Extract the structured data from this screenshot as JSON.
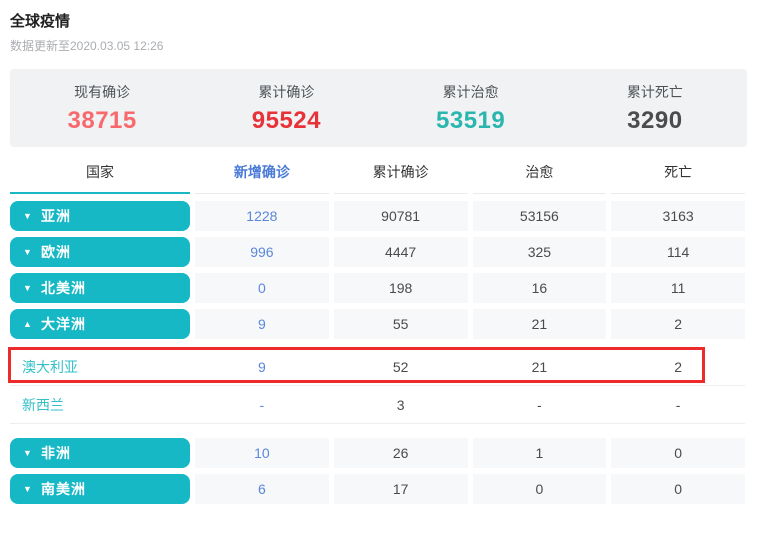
{
  "page": {
    "title": "全球疫情",
    "updated": "数据更新至2020.03.05 12:26"
  },
  "stats": [
    {
      "label": "现有确诊",
      "value": "38715",
      "color": "#f8696e"
    },
    {
      "label": "累计确诊",
      "value": "95524",
      "color": "#e73238"
    },
    {
      "label": "累计治愈",
      "value": "53519",
      "color": "#2ab6ae"
    },
    {
      "label": "累计死亡",
      "value": "3290",
      "color": "#4c4c4c"
    }
  ],
  "table": {
    "columns": [
      "国家",
      "新增确诊",
      "累计确诊",
      "治愈",
      "死亡"
    ],
    "rows": [
      {
        "type": "continent",
        "name": "亚洲",
        "arrow": "▼",
        "expanded": false,
        "new": "1228",
        "total": "90781",
        "cured": "53156",
        "dead": "3163"
      },
      {
        "type": "continent",
        "name": "欧洲",
        "arrow": "▼",
        "expanded": false,
        "new": "996",
        "total": "4447",
        "cured": "325",
        "dead": "114"
      },
      {
        "type": "continent",
        "name": "北美洲",
        "arrow": "▼",
        "expanded": false,
        "new": "0",
        "total": "198",
        "cured": "16",
        "dead": "11"
      },
      {
        "type": "continent",
        "name": "大洋洲",
        "arrow": "▲",
        "expanded": true,
        "new": "9",
        "total": "55",
        "cured": "21",
        "dead": "2"
      },
      {
        "type": "country",
        "name": "澳大利亚",
        "highlighted": true,
        "new": "9",
        "total": "52",
        "cured": "21",
        "dead": "2"
      },
      {
        "type": "country",
        "name": "新西兰",
        "highlighted": false,
        "new": "-",
        "total": "3",
        "cured": "-",
        "dead": "-"
      },
      {
        "type": "continent",
        "name": "非洲",
        "arrow": "▼",
        "expanded": false,
        "new": "10",
        "total": "26",
        "cured": "1",
        "dead": "0"
      },
      {
        "type": "continent",
        "name": "南美洲",
        "arrow": "▼",
        "expanded": false,
        "new": "6",
        "total": "17",
        "cured": "0",
        "dead": "0"
      }
    ]
  },
  "colors": {
    "accent_teal": "#17b8c6",
    "link_blue": "#5b87da",
    "header_blue": "#4a7bd8",
    "highlight_red": "#ee2b2b",
    "cell_bg": "#f7f8fa",
    "stats_bg": "#f0f2f3"
  }
}
